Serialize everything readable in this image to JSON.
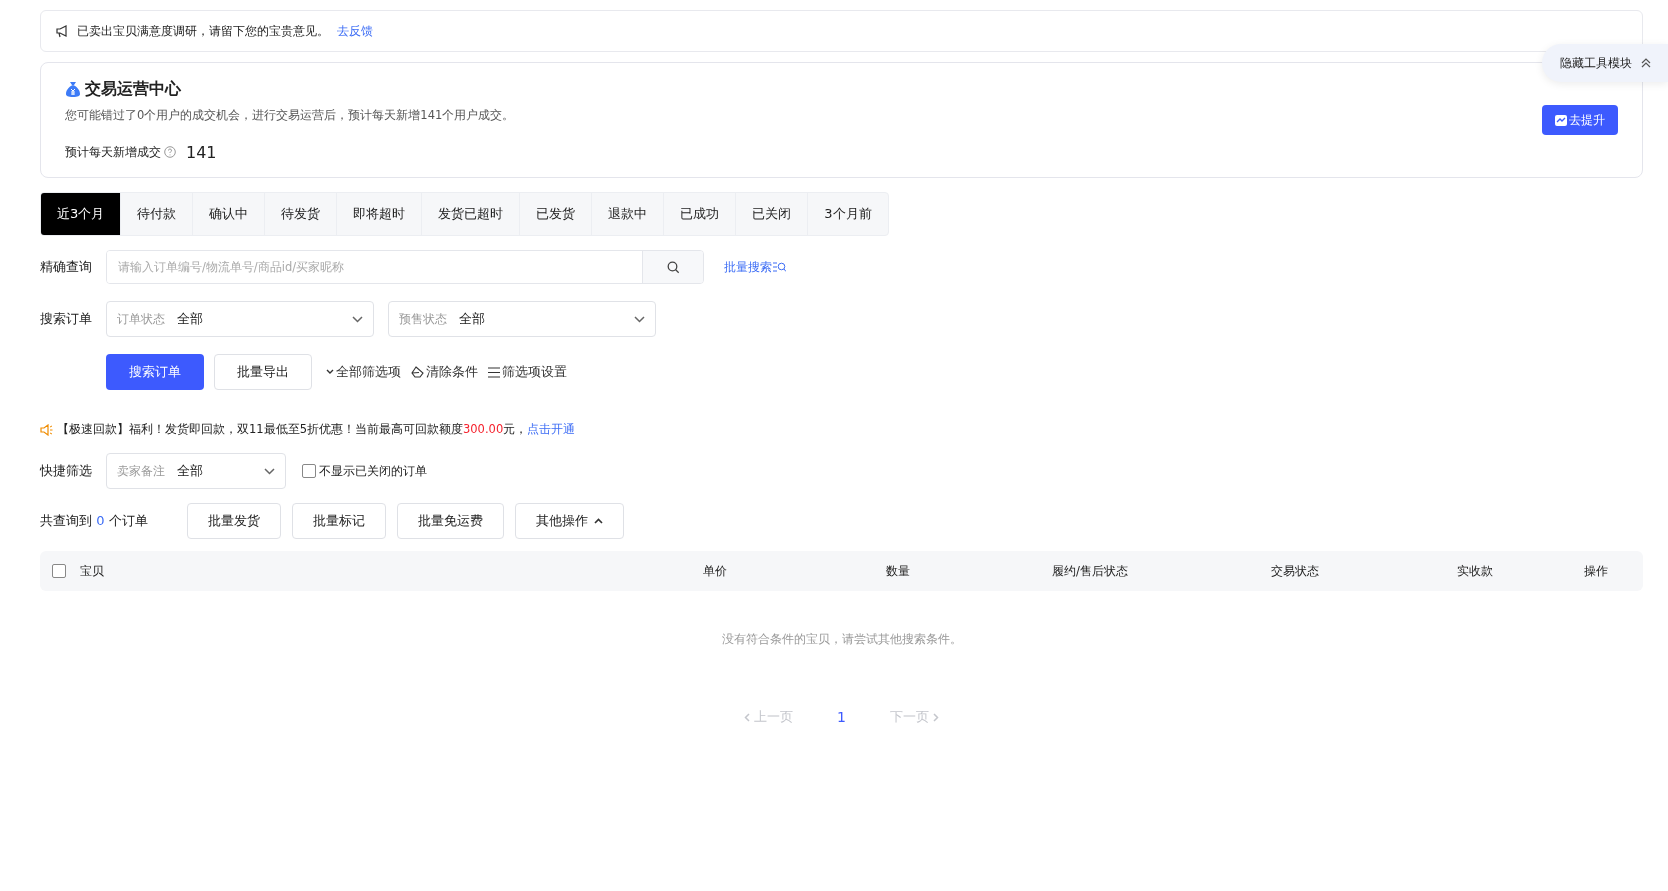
{
  "notice": {
    "text": "已卖出宝贝满意度调研，请留下您的宝贵意见。",
    "link": "去反馈"
  },
  "tool_toggle": {
    "label": "隐藏工具模块"
  },
  "ops_card": {
    "title": "交易运营中心",
    "description": "您可能错过了0个用户的成交机会，进行交易运营后，预计每天新增141个用户成交。",
    "metric_label": "预计每天新增成交",
    "metric_value": "141",
    "button": "去提升"
  },
  "tabs": [
    {
      "label": "近3个月",
      "selected": true
    },
    {
      "label": "待付款",
      "selected": false
    },
    {
      "label": "确认中",
      "selected": false
    },
    {
      "label": "待发货",
      "selected": false
    },
    {
      "label": "即将超时",
      "selected": false
    },
    {
      "label": "发货已超时",
      "selected": false
    },
    {
      "label": "已发货",
      "selected": false
    },
    {
      "label": "退款中",
      "selected": false
    },
    {
      "label": "已成功",
      "selected": false
    },
    {
      "label": "已关闭",
      "selected": false
    },
    {
      "label": "3个月前",
      "selected": false
    }
  ],
  "exact_search": {
    "label": "精确查询",
    "placeholder": "请输入订单编号/物流单号/商品id/买家昵称",
    "batch_link": "批量搜索"
  },
  "order_search": {
    "label": "搜索订单",
    "selects": [
      {
        "prefix": "订单状态",
        "value": "全部"
      },
      {
        "prefix": "预售状态",
        "value": "全部"
      }
    ]
  },
  "actions": {
    "primary": "搜索订单",
    "secondary": "批量导出",
    "links": [
      {
        "kind": "expand",
        "label": "全部筛选项"
      },
      {
        "kind": "clear",
        "label": "清除条件"
      },
      {
        "kind": "settings",
        "label": "筛选项设置"
      }
    ]
  },
  "promo": {
    "text": "【极速回款】福利！发货即回款，双11最低至5折优惠！当前最高可回款额度",
    "amount": "300.00",
    "suffix": "元，",
    "link": "点击开通"
  },
  "quick_filter": {
    "label": "快捷筛选",
    "select": {
      "prefix": "卖家备注",
      "value": "全部"
    },
    "checkbox": {
      "label": "不显示已关闭的订单",
      "checked": false
    }
  },
  "result": {
    "prefix": "共查询到",
    "count": "0",
    "suffix": "个订单",
    "buttons": [
      {
        "label": "批量发货",
        "kind": "plain"
      },
      {
        "label": "批量标记",
        "kind": "plain"
      },
      {
        "label": "批量免运费",
        "kind": "plain"
      },
      {
        "label": "其他操作",
        "kind": "menu"
      }
    ]
  },
  "table": {
    "select_all": {
      "checked": false
    },
    "columns": [
      "宝贝",
      "单价",
      "数量",
      "履约/售后状态",
      "交易状态",
      "实收款",
      "操作"
    ],
    "empty_text": "没有符合条件的宝贝，请尝试其他搜索条件。"
  },
  "pagination": {
    "prev": {
      "label": "上一页",
      "disabled": true
    },
    "pages": [
      {
        "label": "1",
        "selected": true
      }
    ],
    "next": {
      "label": "下一页",
      "disabled": true
    }
  }
}
